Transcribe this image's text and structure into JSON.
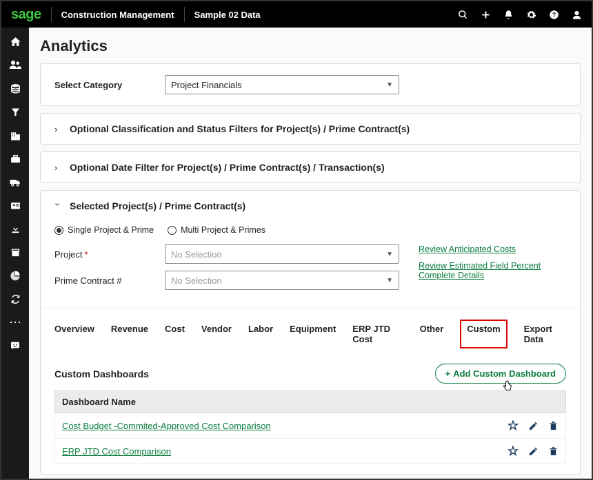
{
  "header": {
    "logo": "sage",
    "app_name": "Construction Management",
    "tenant": "Sample 02 Data"
  },
  "page": {
    "title": "Analytics"
  },
  "category": {
    "label": "Select Category",
    "value": "Project Financials"
  },
  "filters": {
    "classification_title": "Optional Classification and Status Filters for Project(s) / Prime Contract(s)",
    "date_title": "Optional Date Filter for Project(s) / Prime Contract(s) / Transaction(s)"
  },
  "selected": {
    "title": "Selected Project(s) / Prime Contract(s)",
    "radio_single": "Single Project & Prime",
    "radio_multi": "Multi Project & Primes",
    "radio_selected": "single",
    "project_label": "Project",
    "project_placeholder": "No Selection",
    "prime_label": "Prime Contract #",
    "prime_placeholder": "No Selection",
    "link_anticipated": "Review Anticipated Costs",
    "link_estimated": "Review Estimated Field Percent Complete Details"
  },
  "tabs": {
    "items": [
      "Overview",
      "Revenue",
      "Cost",
      "Vendor",
      "Labor",
      "Equipment",
      "ERP JTD Cost",
      "Other",
      "Custom",
      "Export Data"
    ],
    "active": "Custom"
  },
  "dashboards": {
    "section_title": "Custom Dashboards",
    "add_label": "Add Custom Dashboard",
    "col_name": "Dashboard Name",
    "rows": [
      {
        "name": "Cost Budget -Commited-Approved Cost Comparison"
      },
      {
        "name": "ERP JTD Cost Comparison"
      }
    ]
  }
}
